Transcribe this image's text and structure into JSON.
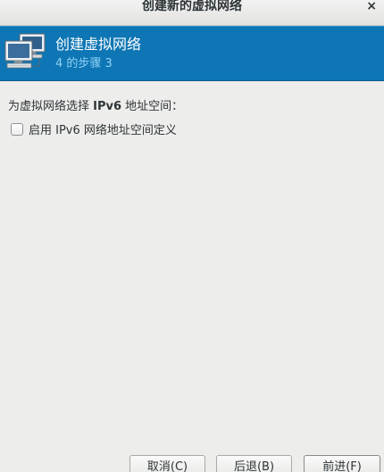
{
  "window": {
    "title": "创建新的虚拟网络",
    "close_glyph": "×"
  },
  "header": {
    "title": "创建虚拟网络",
    "subtitle": "4 的步骤 3",
    "icon": "network-computers-icon",
    "background_color": "#0e76b4"
  },
  "content": {
    "prompt_prefix": "为虚拟网络选择 ",
    "prompt_bold": "IPv6",
    "prompt_suffix": " 地址空间：",
    "checkbox": {
      "label": "启用 IPv6 网络地址空间定义",
      "checked": false
    }
  },
  "buttons": {
    "cancel": "取消(C)",
    "back": "后退(B)",
    "forward": "前进(F)"
  }
}
